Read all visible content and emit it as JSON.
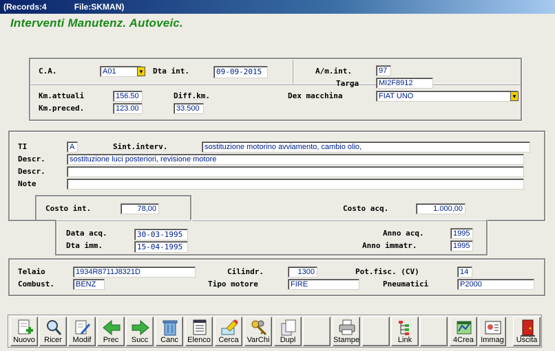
{
  "window": {
    "records": "(Records:4",
    "file": "File:SKMAN)"
  },
  "app_title": "Interventi Manutenz. Autoveic.",
  "vehicle": {
    "ca_label": "C.A.",
    "ca_value": "A01",
    "dta_int_label": "Dta int.",
    "dta_int_value": "09-09-2015",
    "am_int_label": "A/m.int.",
    "am_int_value": "97",
    "targa_label": "Targa",
    "targa_value": "MI2F8912",
    "km_attuali_label": "Km.attuali",
    "km_attuali_value": "156.50",
    "diff_km_label": "Diff.km.",
    "diff_km_value": "33.500",
    "km_preced_label": "Km.preced.",
    "km_preced_value": "123.00",
    "dex_macchina_label": "Dex macchina",
    "dex_macchina_value": "FIAT UNO"
  },
  "intervention": {
    "ti_label": "TI",
    "ti_value": "A",
    "sint_label": "Sint.interv.",
    "sint_value": "sostituzione motorino avviamento, cambio olio,",
    "descr1_label": "Descr.",
    "descr1_value": "sostituzione luci posteriori, revisione motore",
    "descr2_label": "Descr.",
    "descr2_value": "",
    "note_label": "Note",
    "note_value": "",
    "costo_int_label": "Costo int.",
    "costo_int_value": "78,00",
    "costo_acq_label": "Costo acq.",
    "costo_acq_value": "1.000,00"
  },
  "acquisition": {
    "data_acq_label": "Data acq.",
    "data_acq_value": "30-03-1995",
    "dta_imm_label": "Dta imm.",
    "dta_imm_value": "15-04-1995",
    "anno_acq_label": "Anno acq.",
    "anno_acq_value": "1995",
    "anno_immatr_label": "Anno immatr.",
    "anno_immatr_value": "1995"
  },
  "specs": {
    "telaio_label": "Telaio",
    "telaio_value": "1934R8711J8321D",
    "cilindr_label": "Cilindr.",
    "cilindr_value": "1300",
    "pot_fisc_label": "Pot.fisc. (CV)",
    "pot_fisc_value": "14",
    "combust_label": "Combust.",
    "combust_value": "BENZ",
    "tipo_motore_label": "Tipo motore",
    "tipo_motore_value": "FIRE",
    "pneumatici_label": "Pneumatici",
    "pneumatici_value": "P2000"
  },
  "toolbar": {
    "nuovo": "Nuovo",
    "ricer": "Ricer",
    "modif": "Modif",
    "prec": "Prec",
    "succ": "Succ",
    "canc": "Canc",
    "elenco": "Elenco",
    "cerca": "Cerca",
    "varchi": "VarChi",
    "dupl": "Dupl",
    "stampe": "Stampe",
    "link": "Link",
    "crea": "4Crea",
    "immag": "Immag",
    "uscita": "Uscita"
  },
  "icons": [
    "new-document-icon",
    "magnifier-icon",
    "edit-document-icon",
    "arrow-left-icon",
    "arrow-right-icon",
    "trash-can-icon",
    "list-icon",
    "highlighter-icon",
    "keys-icon",
    "duplicate-icon",
    "printer-icon",
    "link-tree-icon",
    "create-icon",
    "image-card-icon",
    "exit-door-icon"
  ],
  "colors": {
    "title_green": "#1a8a1a",
    "field_text": "#00208a",
    "dropdown": "#f2d000"
  }
}
